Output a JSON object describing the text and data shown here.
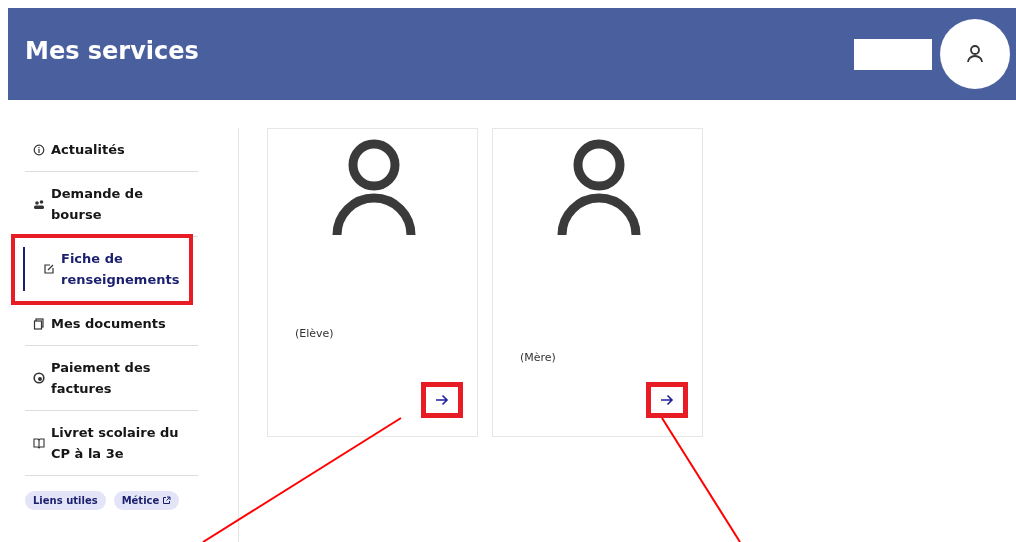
{
  "header": {
    "title": "Mes services"
  },
  "sidebar": {
    "items": [
      {
        "label": "Actualités",
        "kind": "info",
        "selected": false,
        "highlighted": false
      },
      {
        "label": "Demande de bourse",
        "kind": "people",
        "selected": false,
        "highlighted": false
      },
      {
        "label": "Fiche de renseignements",
        "kind": "edit",
        "selected": true,
        "highlighted": true
      },
      {
        "label": "Mes documents",
        "kind": "docs",
        "selected": false,
        "highlighted": false
      },
      {
        "label": "Paiement des factures",
        "kind": "coin",
        "selected": false,
        "highlighted": false
      },
      {
        "label": "Livret scolaire du CP à la 3e",
        "kind": "book",
        "selected": false,
        "highlighted": false
      }
    ],
    "tags": [
      {
        "label": "Liens utiles",
        "external": false
      },
      {
        "label": "Métice",
        "external": true
      }
    ]
  },
  "cards": [
    {
      "role": "(Elève)",
      "highlighted": true
    },
    {
      "role": "(Mère)",
      "highlighted": true
    }
  ]
}
